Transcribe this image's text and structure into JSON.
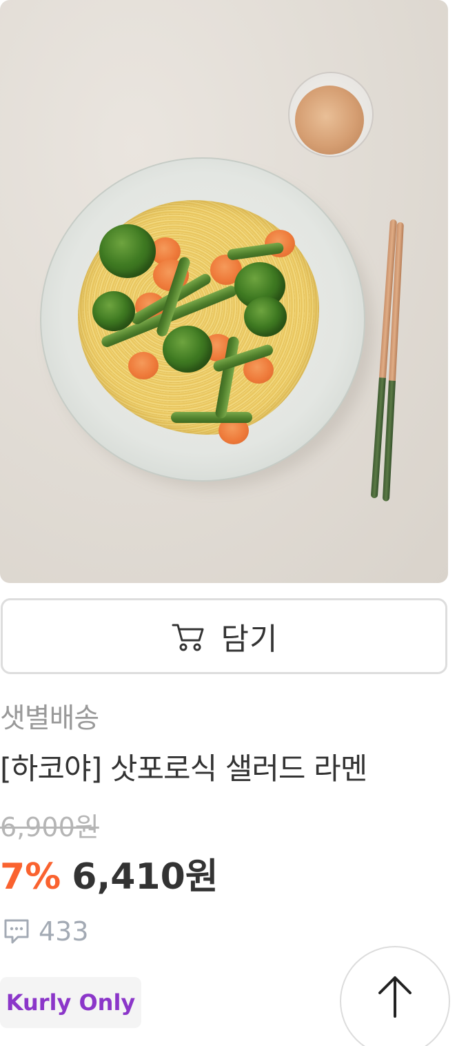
{
  "product": {
    "image_description_icon": "product-photo",
    "cart_button": {
      "icon": "cart-icon",
      "label": "담기"
    },
    "delivery_type": "샛별배송",
    "name": "[하코야] 삿포로식 샐러드 라멘",
    "original_price": "6,900원",
    "discount_rate": "7%",
    "sale_price": "6,410원",
    "reviews": {
      "icon": "review-bubble-icon",
      "count": "433"
    },
    "badge": {
      "label": "Kurly Only",
      "color": "#8b36c9"
    }
  },
  "scroll_top": {
    "icon": "arrow-up-icon"
  },
  "colors": {
    "discount": "#fa622f",
    "text_primary": "#333333",
    "text_muted": "#999999",
    "border": "#dddddd"
  }
}
